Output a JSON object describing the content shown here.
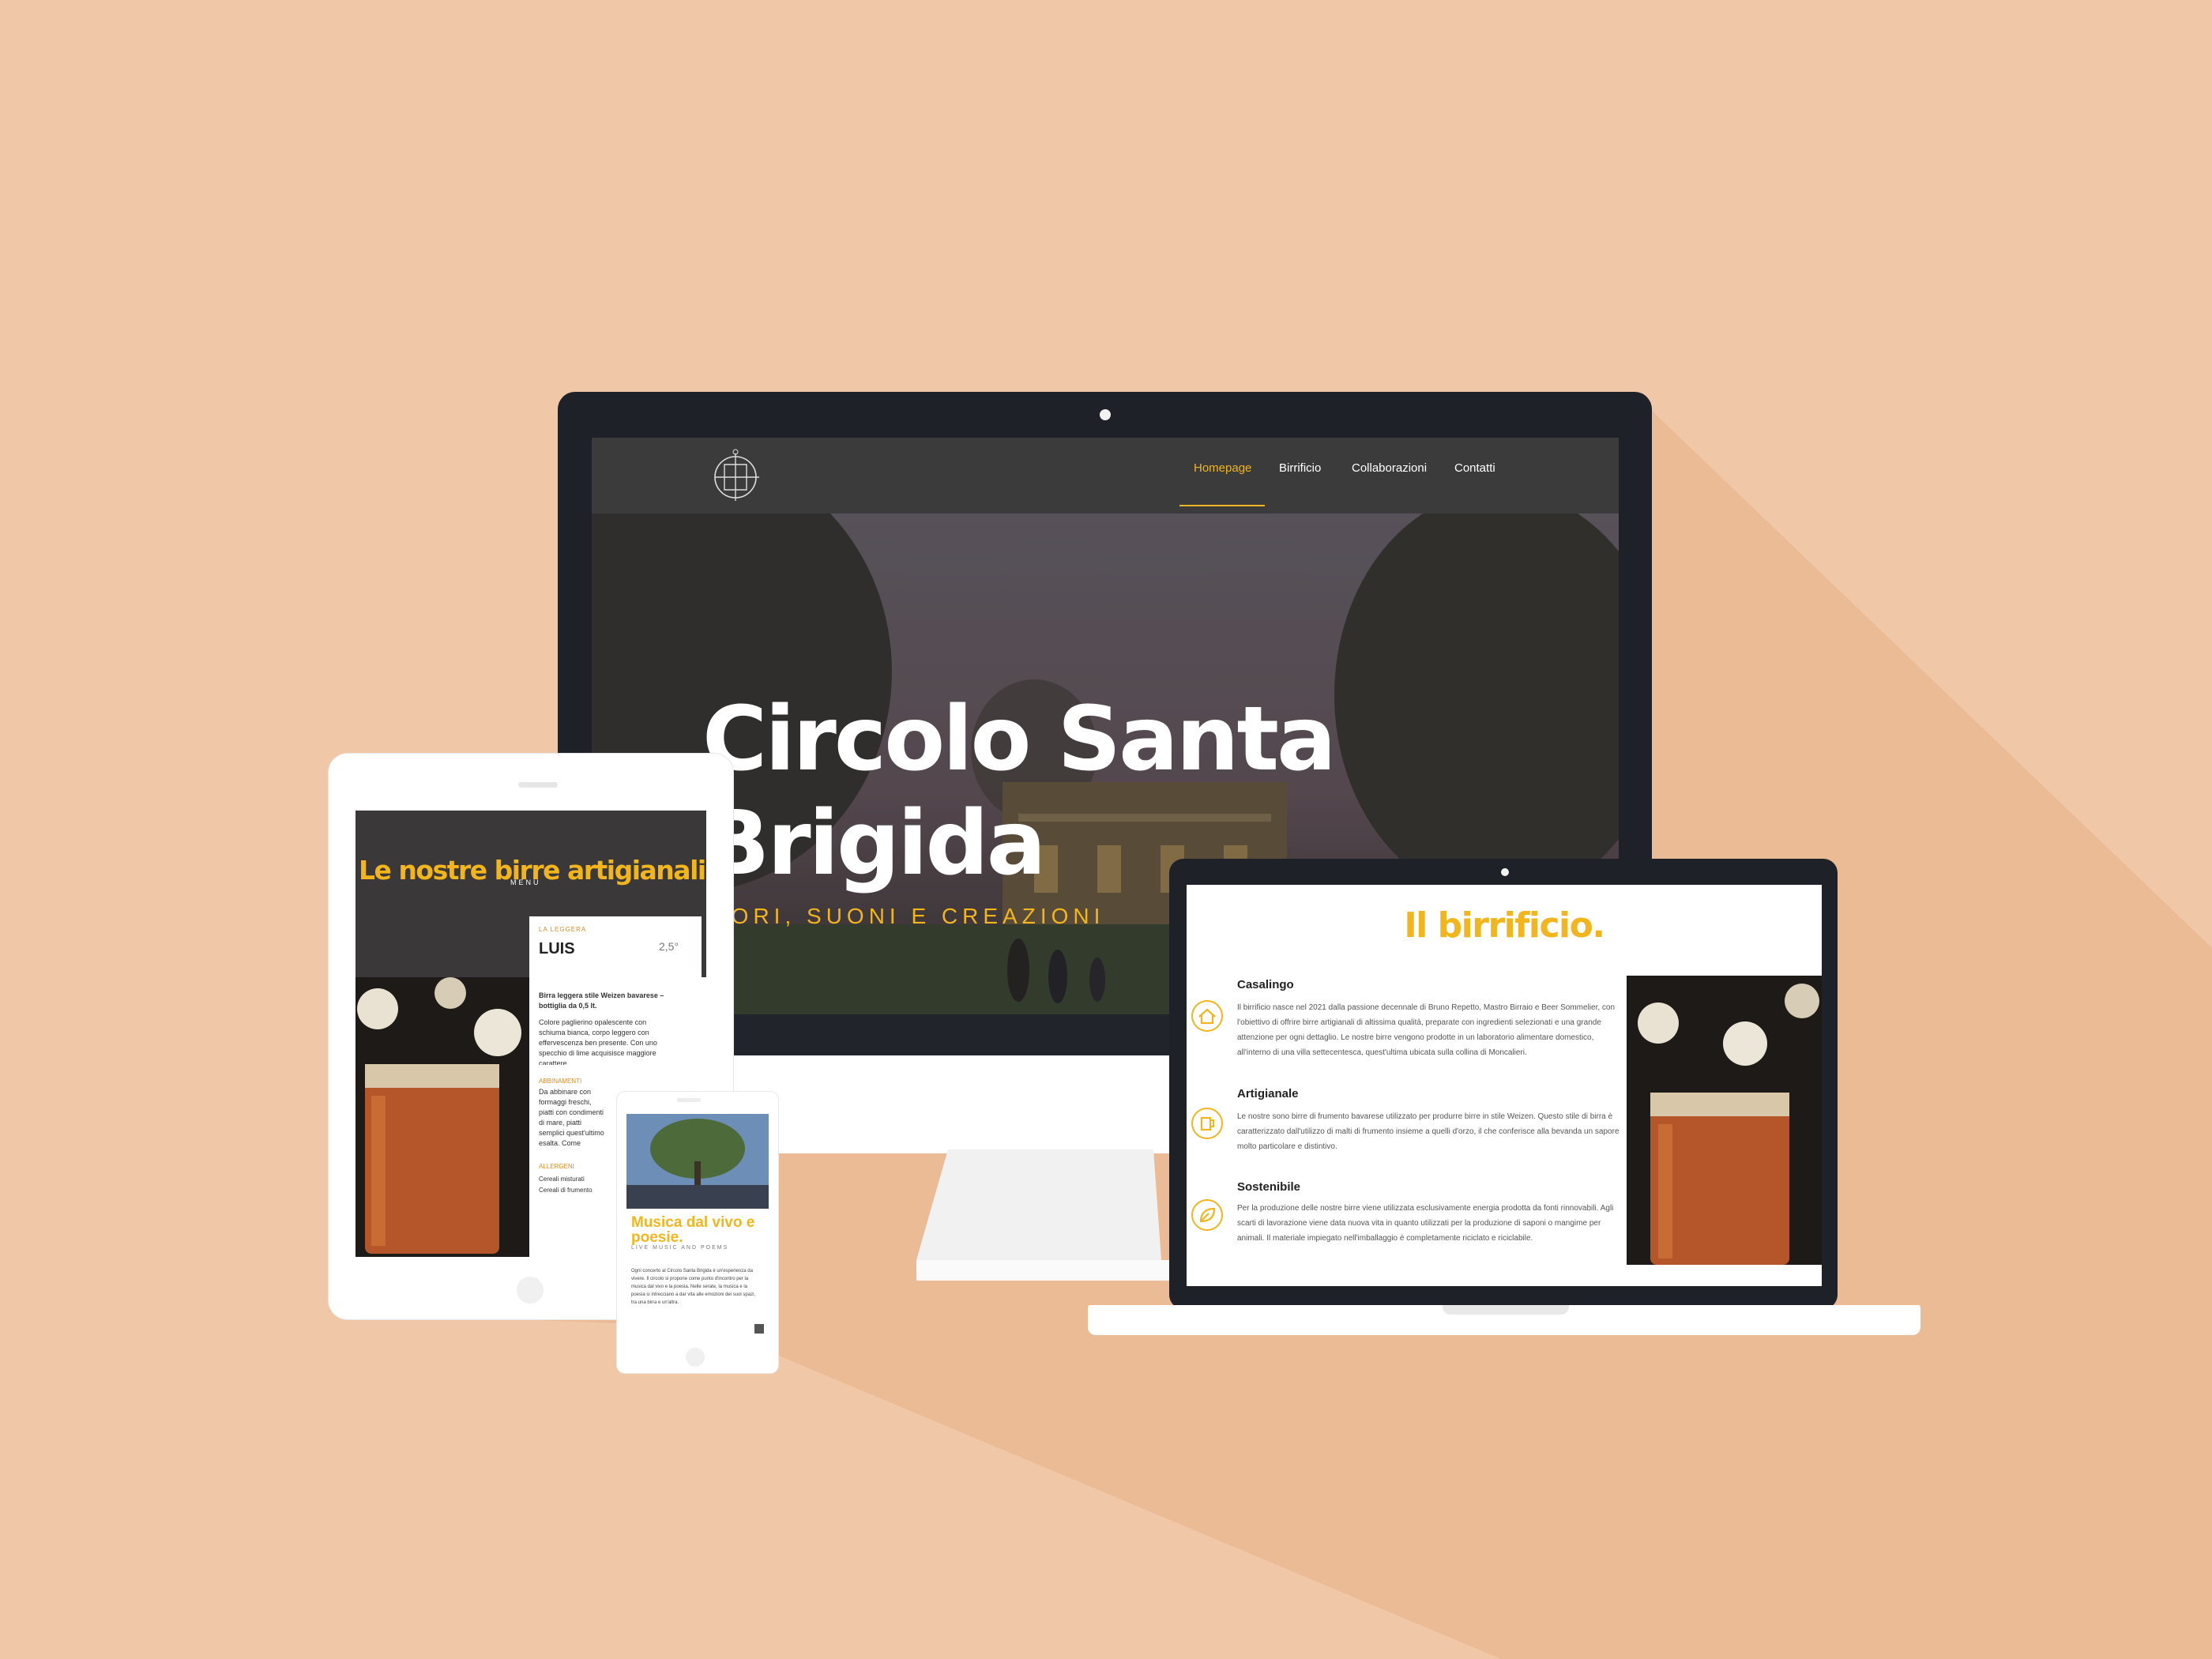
{
  "colors": {
    "background": "#f0c7a7",
    "accent": "#f2b51b",
    "device_dark": "#1f2128"
  },
  "desktop": {
    "nav": {
      "items": [
        {
          "label": "Homepage",
          "active": true
        },
        {
          "label": "Birrificio",
          "active": false
        },
        {
          "label": "Collaborazioni",
          "active": false
        },
        {
          "label": "Contatti",
          "active": false
        }
      ]
    },
    "hero": {
      "title_line1": "Circolo Santa",
      "title_line2": "Brigida",
      "subtitle": "PORI, SUONI E CREAZIONI"
    }
  },
  "tablet": {
    "header_title": "Le nostre birre artigianali.",
    "menu_label": "MENU",
    "beer": {
      "category": "LA LEGGERA",
      "name": "LUIS",
      "abv": "2,5°",
      "description": "Birra leggera stile Weizen bavarese – bottiglia da 0,5 lt.",
      "body": "Colore paglierino opalescente con schiuma bianca, corpo leggero con effervescenza ben presente. Con uno specchio di lime acquisisce maggiore carattere.",
      "pairings_label": "ABBINAMENTI",
      "pairings_text": "Da abbinare con formaggi freschi, piatti con condimenti di mare, piatti semplici quest'ultimo esalta. Come dessert consigliato della frutta...",
      "allergens_label": "ALLERGENI",
      "allergens": [
        "Cereali misturati",
        "Cereali di frumento"
      ]
    }
  },
  "phone": {
    "title": "Musica dal vivo e poesie.",
    "subtitle": "LIVE MUSIC AND POEMS",
    "body": "Ogni concerto al Circolo Santa Brigida è un'esperienza da vivere. Il circolo si propone come punto d'incontro per la musica dal vivo e la poesia. Nelle serate, la musica e la poesia si intrecciano a dar vita alle emozioni dei suoi spazi, tra una birra e un'altra."
  },
  "laptop": {
    "title": "Il birrificio.",
    "features": [
      {
        "title": "Casalingo",
        "icon": "home-icon",
        "text": "Il birrificio nasce nel 2021 dalla passione decennale di Bruno Repetto, Mastro Birraio e Beer Sommelier, con l'obiettivo di offrire birre artigianali di altissima qualità, preparate con ingredienti selezionati e una grande attenzione per ogni dettaglio. Le nostre birre vengono prodotte in un laboratorio alimentare domestico, all'interno di una villa settecentesca, quest'ultima ubicata sulla collina di Moncalieri."
      },
      {
        "title": "Artigianale",
        "icon": "beer-mug-icon",
        "text": "Le nostre sono birre di frumento bavarese utilizzato per produrre birre in stile Weizen. Questo stile di birra è caratterizzato dall'utilizzo di malti di frumento insieme a quelli d'orzo, il che conferisce alla bevanda un sapore molto particolare e distintivo."
      },
      {
        "title": "Sostenibile",
        "icon": "leaf-icon",
        "text": "Per la produzione delle nostre birre viene utilizzata esclusivamente energia prodotta da fonti rinnovabili. Agli scarti di lavorazione viene data nuova vita in quanto utilizzati per la produzione di saponi o mangime per animali. Il materiale impiegato nell'imballaggio è completamente riciclato e riciclabile."
      }
    ]
  }
}
